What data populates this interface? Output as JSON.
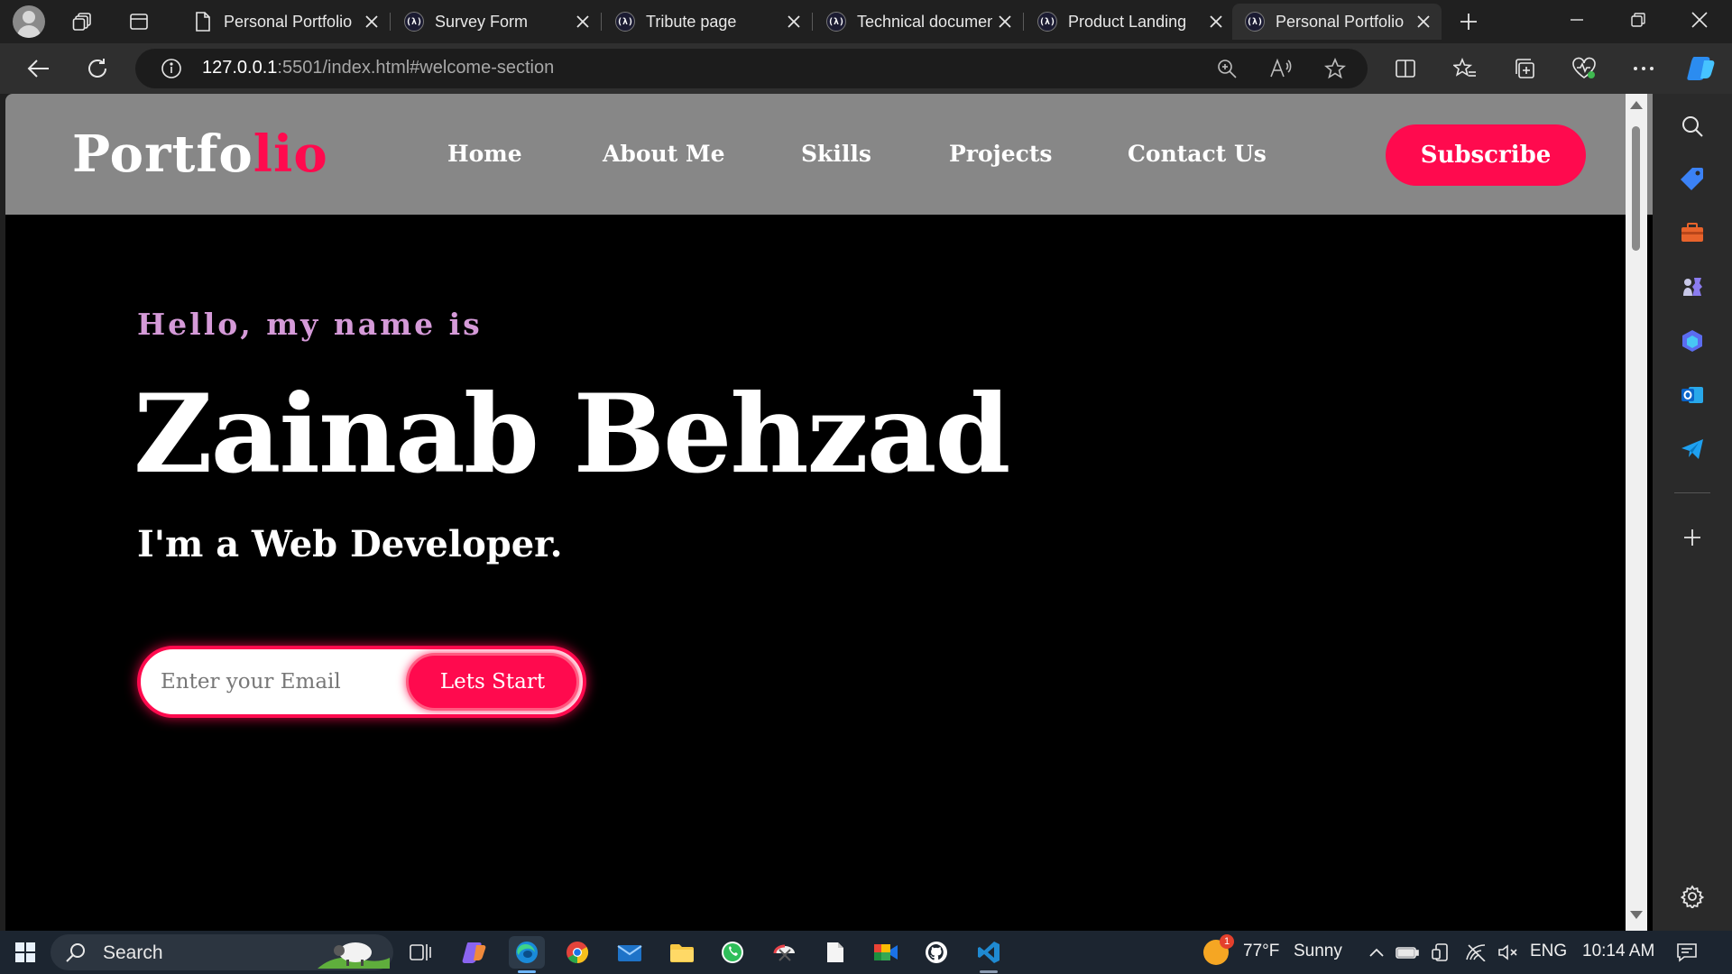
{
  "browser": {
    "tabs": [
      {
        "title": "Personal Portfolio",
        "favicon": "document-icon",
        "active": false
      },
      {
        "title": "Survey Form",
        "favicon": "freecodecamp-icon",
        "active": false
      },
      {
        "title": "Tribute page",
        "favicon": "freecodecamp-icon",
        "active": false
      },
      {
        "title": "Technical documentation",
        "favicon": "freecodecamp-icon",
        "active": false
      },
      {
        "title": "Product Landing",
        "favicon": "freecodecamp-icon",
        "active": false
      },
      {
        "title": "Personal Portfolio",
        "favicon": "freecodecamp-icon",
        "active": true
      }
    ],
    "fcc_glyph": "(λ)",
    "address": {
      "host": "127.0.0.1",
      "rest": ":5501/index.html#welcome-section"
    }
  },
  "site": {
    "logo": {
      "part1": "Portfo",
      "part2": "lio"
    },
    "nav": [
      "Home",
      "About Me",
      "Skills",
      "Projects",
      "Contact Us"
    ],
    "subscribe_label": "Subscribe",
    "hero": {
      "greeting": "Hello, my name is",
      "name": "Zainab Behzad",
      "role": "I'm a Web Developer.",
      "email_placeholder": "Enter your Email",
      "cta_label": "Lets Start"
    },
    "colors": {
      "accent": "#ff0a4e",
      "greeting": "#d59ad8",
      "nav_bg": "#878787",
      "hero_bg": "#000000"
    }
  },
  "taskbar": {
    "search_label": "Search",
    "weather": {
      "temp": "77°F",
      "condition": "Sunny",
      "badge": "1"
    },
    "language": "ENG",
    "time": "10:14 AM"
  }
}
